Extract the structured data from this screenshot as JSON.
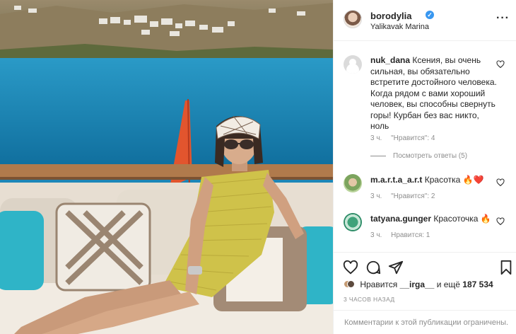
{
  "colors": {
    "verified": "#3897f0",
    "secondary_text": "#8e8e8e",
    "primary_text": "#262626",
    "like_heart": "#ed4956",
    "sea": "#1c86b8"
  },
  "post": {
    "author": "borodylia",
    "location": "Yalikavak Marina",
    "more_icon": "more-horizontal-icon"
  },
  "comments": [
    {
      "username": "nuk_dana",
      "text": "Ксения, вы очень сильная, вы обязательно встретите достойного человека. Когда рядом с вами хороший человек, вы способны свернуть горы! Курбан без вас никто, ноль",
      "time": "3 ч.",
      "likes": "\"Нравится\": 4",
      "replies": "Посмотреть ответы (5)"
    },
    {
      "username": "m.a.r.t.a_a.r.t",
      "text": "Красотка 🔥❤️",
      "time": "3 ч.",
      "likes": "\"Нравится\": 2"
    },
    {
      "username": "tatyana.gunger",
      "text": "Красоточка 🔥",
      "time": "3 ч.",
      "likes": "Нравится: 1"
    }
  ],
  "actions": {
    "like": "heart-icon",
    "comment": "comment-icon",
    "share": "share-icon",
    "save": "bookmark-icon"
  },
  "likes": {
    "prefix": "Нравится",
    "user": "__irga__",
    "suffix": "и ещё",
    "count": "187 534"
  },
  "timestamp": "3 ЧАСОВ НАЗАД",
  "comments_limited": "Комментарии к этой публикации ограничены."
}
